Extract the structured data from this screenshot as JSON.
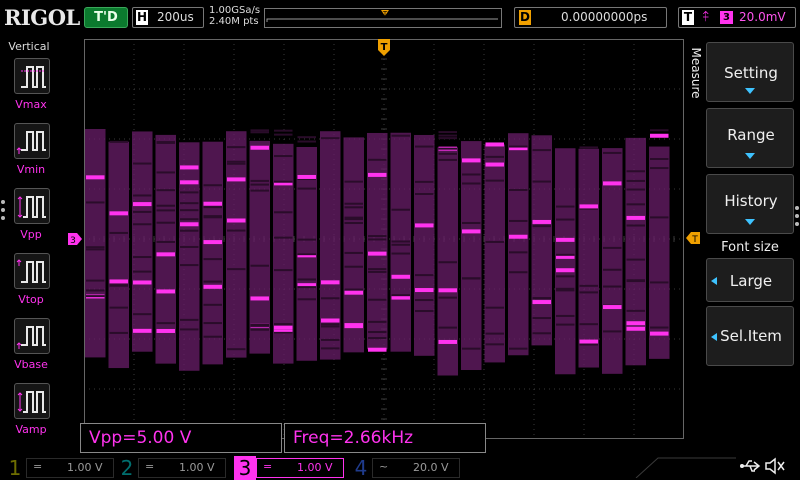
{
  "brand": "RIGOL",
  "status": {
    "run_label": "T'D"
  },
  "timebase": {
    "letter": "H",
    "value": "200us"
  },
  "acquisition": {
    "sample_rate": "1.00GSa/s",
    "memory_depth": "2.40M pts"
  },
  "delay": {
    "letter": "D",
    "value": "0.00000000ps"
  },
  "trigger": {
    "letter": "T",
    "edge_icon": "rising-falling-edge-icon",
    "source": "3",
    "level": "20.0mV",
    "marker_letter": "T"
  },
  "left_panel": {
    "title": "Vertical",
    "items": [
      {
        "label": "Vmax",
        "icon": "vmax-pulse-icon"
      },
      {
        "label": "Vmin",
        "icon": "vmin-pulse-icon"
      },
      {
        "label": "Vpp",
        "icon": "vpp-pulse-icon"
      },
      {
        "label": "Vtop",
        "icon": "vtop-pulse-icon"
      },
      {
        "label": "Vbase",
        "icon": "vbase-pulse-icon"
      },
      {
        "label": "Vamp",
        "icon": "vamp-pulse-icon"
      }
    ]
  },
  "channel_marker": "3",
  "measurements": [
    {
      "text": "Vpp=5.00 V"
    },
    {
      "text": "Freq=2.66kHz"
    }
  ],
  "menu": {
    "title": "Measure",
    "setting": "Setting",
    "range": "Range",
    "history": "History",
    "font_size_title": "Font size",
    "font_size_value": "Large",
    "sel_item": "Sel.Item"
  },
  "channels": [
    {
      "num": "1",
      "coupling": "=",
      "scale": "1.00 V",
      "color": "#c8c800",
      "active": false
    },
    {
      "num": "2",
      "coupling": "=",
      "scale": "1.00 V",
      "color": "#00c8c8",
      "active": false
    },
    {
      "num": "3",
      "coupling": "=",
      "scale": "1.00 V",
      "color": "#ff33ee",
      "active": true
    },
    {
      "num": "4",
      "coupling": "~",
      "scale": "20.0 V",
      "color": "#3a6cff",
      "active": false
    }
  ],
  "colors": {
    "trace": "#ff33ee",
    "trace_dim": "#6a1e6a",
    "grid": "#3a3a3a",
    "trigger_orange": "#f0a000",
    "menu_arrow": "#3ec3ff"
  }
}
